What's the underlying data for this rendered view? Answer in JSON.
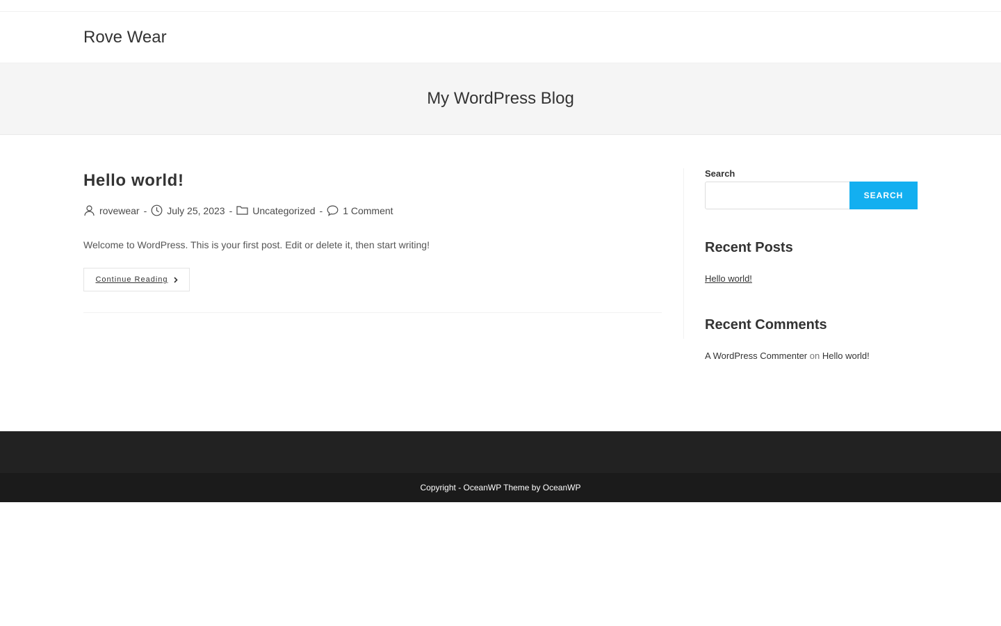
{
  "site": {
    "title": "Rove Wear"
  },
  "page_header": {
    "title": "My WordPress Blog"
  },
  "post": {
    "title": "Hello world!",
    "author": "rovewear",
    "date": "July 25, 2023",
    "category": "Uncategorized",
    "comments": "1 Comment",
    "excerpt": "Welcome to WordPress. This is your first post. Edit or delete it, then start writing!",
    "continue_label": "Continue Reading",
    "separator": "-"
  },
  "sidebar": {
    "search": {
      "label": "Search",
      "value": "",
      "placeholder": "",
      "button_label": "SEARCH"
    },
    "recent_posts": {
      "title": "Recent Posts",
      "items": [
        "Hello world!"
      ]
    },
    "recent_comments": {
      "title": "Recent Comments",
      "author": "A WordPress Commenter",
      "on": "on",
      "post": "Hello world!"
    }
  },
  "footer": {
    "copyright": "Copyright - OceanWP Theme by OceanWP"
  },
  "colors": {
    "accent": "#13aff0",
    "footer_bg": "#222222",
    "footer_bottom_bg": "#1b1b1b"
  },
  "icons": [
    "user-icon",
    "clock-icon",
    "folder-icon",
    "comment-icon",
    "chevron-right-icon"
  ]
}
